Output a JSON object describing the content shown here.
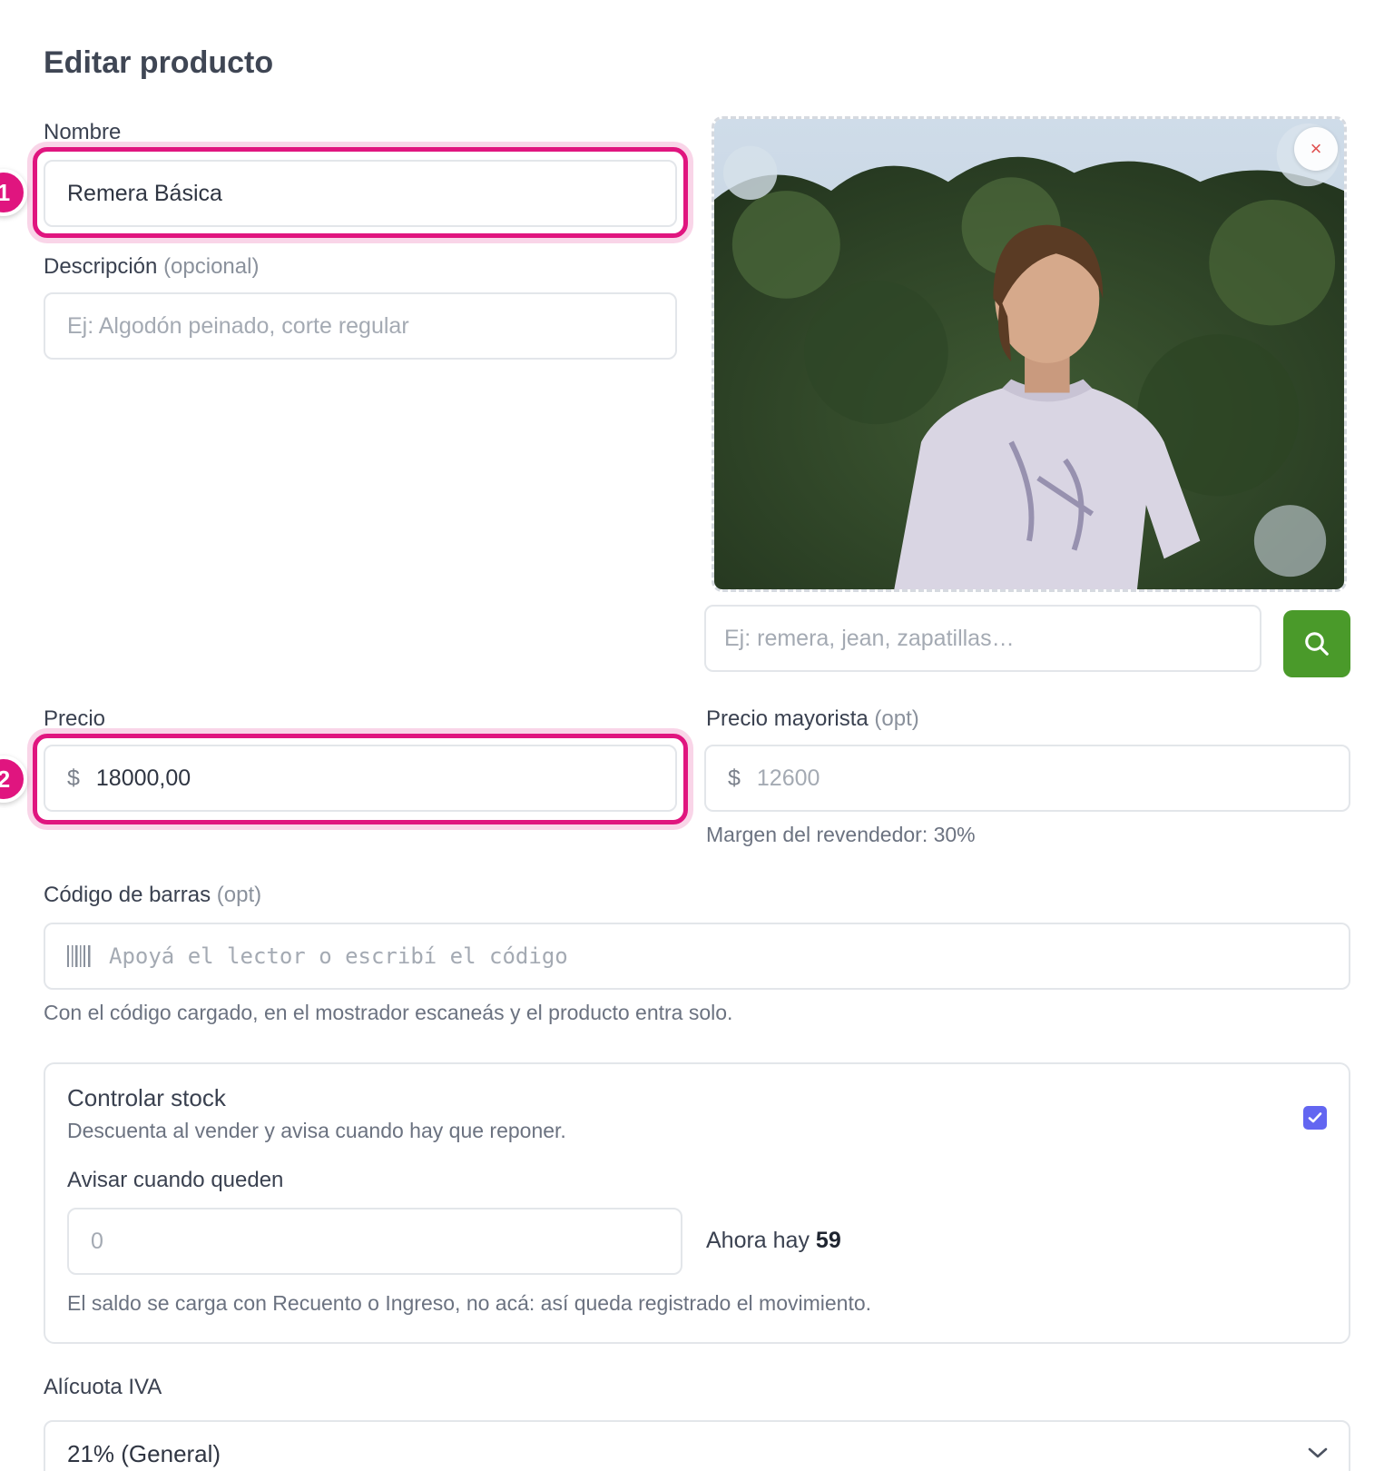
{
  "page": {
    "title": "Editar producto"
  },
  "nombre": {
    "label": "Nombre",
    "value": "Remera Básica",
    "marker": "1"
  },
  "descripcion": {
    "label": "Descripción",
    "optional": "(opcional)",
    "placeholder": "Ej: Algodón peinado, corte regular"
  },
  "image": {
    "search_placeholder": "Ej: remera, jean, zapatillas…",
    "remove_label": "×"
  },
  "precio": {
    "label": "Precio",
    "currency": "$",
    "value": "18000,00",
    "marker": "2"
  },
  "precio_mayorista": {
    "label": "Precio mayorista",
    "optional": "(opt)",
    "currency": "$",
    "placeholder": "12600",
    "hint": "Margen del revendedor: 30%"
  },
  "codigo_barras": {
    "label": "Código de barras",
    "optional": "(opt)",
    "placeholder": "Apoyá el lector o escribí el código",
    "hint": "Con el código cargado, en el mostrador escaneás y el producto entra solo."
  },
  "stock": {
    "title": "Controlar stock",
    "description": "Descuenta al vender y avisa cuando hay que reponer.",
    "checked": true,
    "alert_label": "Avisar cuando queden",
    "alert_placeholder": "0",
    "current_prefix": "Ahora hay",
    "current_value": "59",
    "note": "El saldo se carga con Recuento o Ingreso, no acá: así queda registrado el movimiento."
  },
  "iva": {
    "label": "Alícuota IVA",
    "selected": "21% (General)"
  },
  "colors": {
    "accent_highlight": "#e0157f",
    "search_button": "#4a9a2a",
    "checkbox": "#6366f1"
  }
}
